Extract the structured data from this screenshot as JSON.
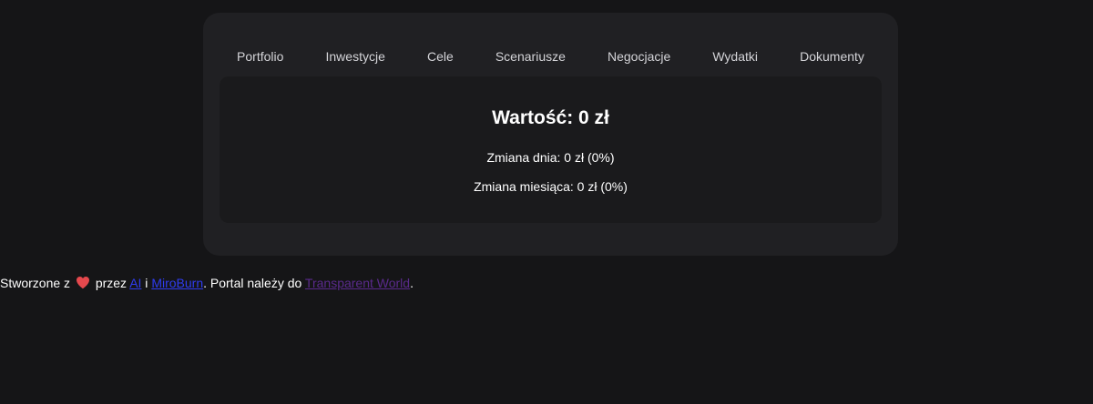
{
  "nav": {
    "tabs": [
      {
        "label": "Portfolio"
      },
      {
        "label": "Inwestycje"
      },
      {
        "label": "Cele"
      },
      {
        "label": "Scenariusze"
      },
      {
        "label": "Negocjacje"
      },
      {
        "label": "Wydatki"
      },
      {
        "label": "Dokumenty"
      }
    ]
  },
  "summary": {
    "value_label": "Wartość: 0 zł",
    "day_change": "Zmiana dnia: 0 zł (0%)",
    "month_change": "Zmiana miesiąca: 0 zł (0%)"
  },
  "footer": {
    "prefix": "Stworzone z",
    "heart_icon": "heart-icon",
    "heart_color": "#e5484d",
    "by": " przez ",
    "link_ai": "AI",
    "and": " i ",
    "link_miroburn": "MiroBurn",
    "portal_text": ". Portal należy do ",
    "link_transparent_world": "Transparent World",
    "suffix": "."
  },
  "colors": {
    "background": "#151517",
    "panel": "#202023",
    "card": "#1a1a1c",
    "link": "#2f3cf0",
    "visited_link": "#5a2a8c"
  }
}
